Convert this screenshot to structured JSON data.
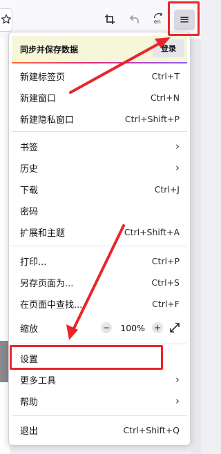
{
  "menu": {
    "sync": {
      "label": "同步并保存数据",
      "signin": "登录"
    },
    "items": [
      {
        "label": "新建标签页",
        "shortcut": "Ctrl+T"
      },
      {
        "label": "新建窗口",
        "shortcut": "Ctrl+N"
      },
      {
        "label": "新建隐私窗口",
        "shortcut": "Ctrl+Shift+P"
      },
      {
        "label": "书签",
        "shortcut": ""
      },
      {
        "label": "历史",
        "shortcut": ""
      },
      {
        "label": "下载",
        "shortcut": "Ctrl+J"
      },
      {
        "label": "密码",
        "shortcut": ""
      },
      {
        "label": "扩展和主题",
        "shortcut": "Ctrl+Shift+A"
      },
      {
        "label": "打印...",
        "shortcut": "Ctrl+P"
      },
      {
        "label": "另存页面为...",
        "shortcut": "Ctrl+S"
      },
      {
        "label": "在页面中查找...",
        "shortcut": "Ctrl+F"
      },
      {
        "label": "缩放",
        "shortcut": ""
      },
      {
        "label": "设置",
        "shortcut": ""
      },
      {
        "label": "更多工具",
        "shortcut": ""
      },
      {
        "label": "帮助",
        "shortcut": ""
      },
      {
        "label": "退出",
        "shortcut": "Ctrl+Shift+Q"
      }
    ],
    "zoom": {
      "minus": "−",
      "value": "100%",
      "plus": "+"
    },
    "chevron": "›"
  },
  "toolbar": {
    "menu_glyph": "≡",
    "translate_badge": "en"
  },
  "colors": {
    "annotation": "#e8262a",
    "sync_bg": "#f6f6d8",
    "menu_button_bg": "#d8d8de"
  }
}
